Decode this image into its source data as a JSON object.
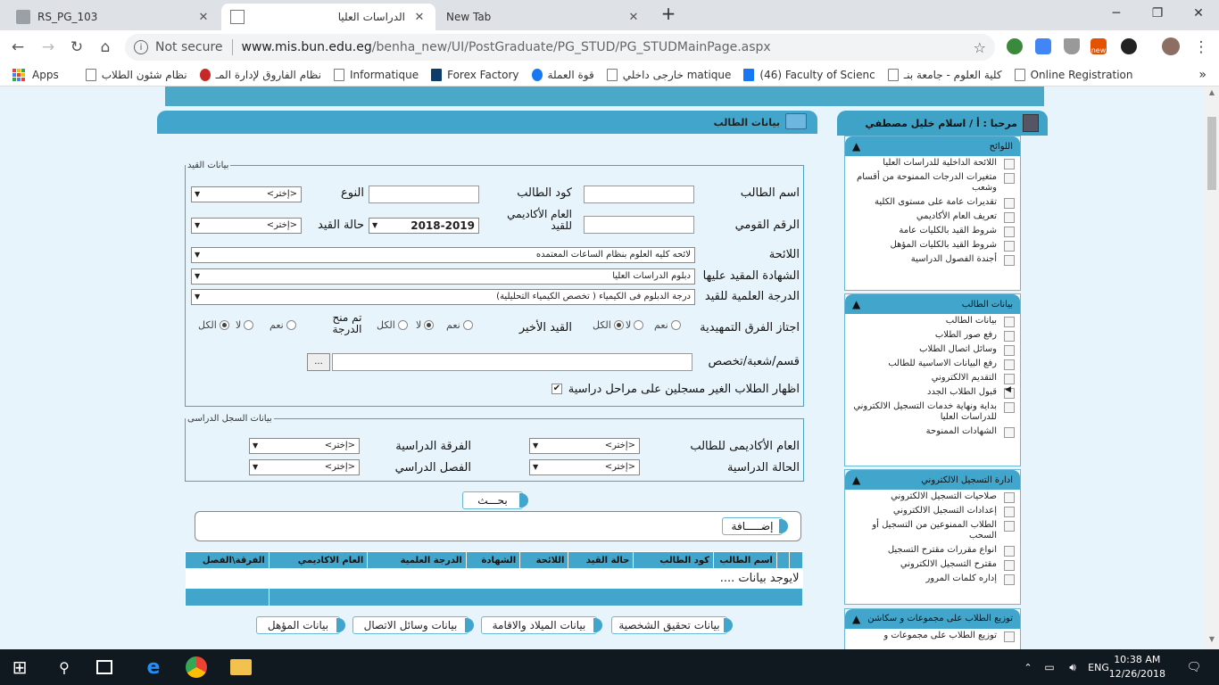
{
  "browser": {
    "tabs": [
      {
        "title": "RS_PG_103",
        "close": "✕"
      },
      {
        "title": "الدراسات العليا",
        "close": "✕"
      },
      {
        "title": "New Tab",
        "close": "✕"
      }
    ],
    "new_tab": "+",
    "window_controls": {
      "minimize": "─",
      "restore": "❐",
      "close": "✕"
    },
    "nav": {
      "back": "←",
      "forward": "→",
      "reload": "↻",
      "home": "⌂"
    },
    "not_secure": "Not secure",
    "url_host": "www.mis.bun.edu.eg",
    "url_path": "/benha_new/UI/PostGraduate/PG_STUD/PG_STUDMainPage.aspx",
    "star": "☆",
    "menu": "⋮",
    "ext_badge": "new",
    "bookmarks": [
      "Apps",
      "نظام شئون الطلاب",
      "نظام الفاروق لإدارة المـ",
      "Informatique",
      "Forex Factory",
      "قوة العملة",
      "خارجى داخلي matique",
      "(46) Faculty of Scienc",
      "كلية العلوم - جامعة بنـ",
      "Online Registration"
    ],
    "bookmarks_more": "»"
  },
  "sidebar": {
    "welcome": "مرحبا : أ / اسلام خليل مصطفي",
    "sections": [
      {
        "title": "اللوائح",
        "arrow": "▲",
        "items": [
          "اللائحة الداخلية للدراسات العليا",
          "متغيرات الدرجات الممنوحة من أقسام وشعب",
          "تقديرات عامة على مستوى الكلية",
          "تعريف العام الأكاديمي",
          "شروط القيد بالكليات عامة",
          "شروط القيد بالكليات المؤهل",
          "أجندة الفصول الدراسية"
        ]
      },
      {
        "title": "بيانات الطالب",
        "arrow": "▲",
        "items": [
          "بيانات الطالب",
          "رفع صور الطلاب",
          "وسائل اتصال الطلاب",
          "رفع البيانات الاساسية للطالب",
          "التقديم الالكتروني",
          "قبول الطلاب الجدد",
          "بداية ونهاية خدمات التسجيل الالكتروني للدراسات العليا",
          "الشهادات الممنوحة"
        ]
      },
      {
        "title": "ادارة التسجيل الالكتروني",
        "arrow": "▲",
        "items": [
          "صلاحيات التسجيل الالكتروني",
          "إعدادات التسجيل الالكتروني",
          "الطلاب الممنوعين من التسجيل أو السحب",
          "انواع مقررات مقترح التسجيل",
          "مقترح التسجيل الالكتروني",
          "إداره كلمات المرور"
        ]
      },
      {
        "title": "توزيع الطلاب على مجموعات و سكاشن",
        "arrow": "▲",
        "items": [
          "توزيع الطلاب على مجموعات و"
        ]
      }
    ],
    "side_marker": "◀"
  },
  "main": {
    "title": "بيانات الطالب",
    "reg_legend": "بيانات القيد",
    "labels": {
      "student_name": "اسم الطالب",
      "student_code": "كود الطالب",
      "gender": "النوع",
      "national_id": "الرقم القومي",
      "academic_year": "العام الأكاديمي للقيد",
      "reg_status": "حالة القيد",
      "regulation": "اللائحة",
      "certificate": "الشهادة المقيد عليها",
      "degree": "الدرجة العلمية للقيد",
      "prep_passed": "اجتاز الفرق التمهيدية",
      "last_reg": "القيد الأخير",
      "granted": "تم منح الدرجة",
      "department": "قسم/شعبة/تخصص",
      "show_unregistered": "اظهار الطلاب الغير مسجلين على مراحل دراسية"
    },
    "values": {
      "gender": "<إختر>",
      "reg_status": "<إختر>",
      "academic_year": "2018-2019",
      "regulation": "لائحه كليه العلوم بنظام الساعات المعتمده",
      "certificate": "دبلوم الدراسات العليا",
      "degree": "درجة الدبلوم فى الكيمياء ( تخصص الكيمياء التحليلية)",
      "browse": "...",
      "checked": "✔"
    },
    "radio": {
      "yes": "نعم",
      "no": "لا",
      "all": "الكل"
    },
    "record_legend": "بيانات السجل الدراسى",
    "record_labels": {
      "year": "العام الأكاديمى للطالب",
      "level": "الفرقة الدراسية",
      "status": "الحالة الدراسية",
      "semester": "الفصل الدراسي"
    },
    "choose": "<إختر>",
    "dd_arrow": "▼",
    "search_btn": "بحـــث",
    "add_btn": "إضـــــافة",
    "table_headers": [
      "",
      "",
      "اسم الطالب",
      "كود الطالب",
      "حالة القيد",
      "اللائحة",
      "الشهادة",
      "الدرجة العلمية",
      "العام الاكاديمي",
      "الفرقة\\الفصل"
    ],
    "no_data": "لايوجد بيانات ....",
    "bottom_tabs": [
      "بيانات تحقيق الشخصية",
      "بيانات الميلاد والاقامة",
      "بيانات وسائل الاتصال",
      "بيانات المؤهل"
    ]
  },
  "taskbar": {
    "time": "10:38 AM",
    "date": "12/26/2018",
    "lang": "ENG",
    "start": "⊞",
    "search": "⚲",
    "notif": "🗨"
  }
}
